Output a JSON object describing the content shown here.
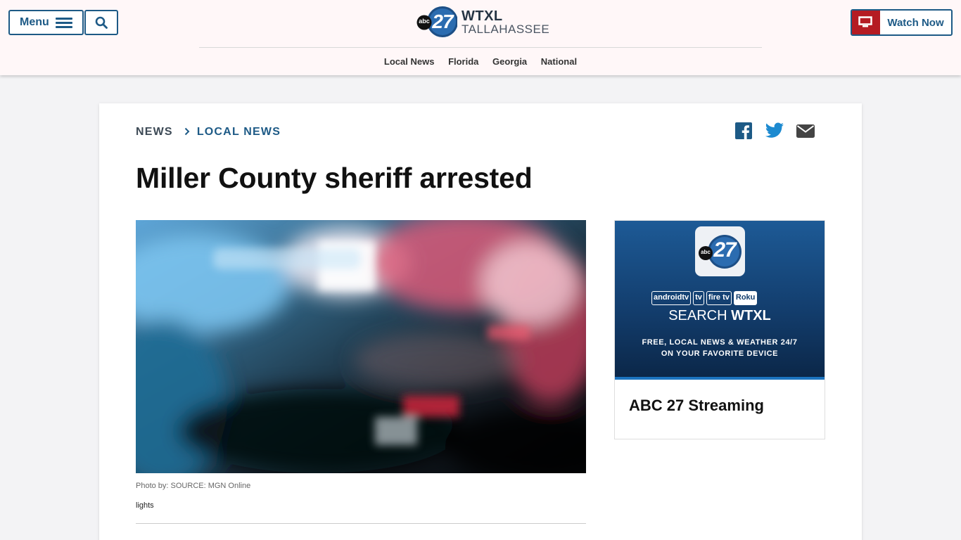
{
  "header": {
    "menu_label": "Menu",
    "logo": {
      "abc": "abc",
      "number": "27",
      "call_sign": "WTXL",
      "city": "TALLAHASSEE"
    },
    "nav": [
      "Local News",
      "Florida",
      "Georgia",
      "National"
    ],
    "watch_label": "Watch Now"
  },
  "breadcrumb": {
    "parent": "NEWS",
    "current": "LOCAL NEWS"
  },
  "share": [
    "facebook-icon",
    "twitter-icon",
    "email-icon"
  ],
  "article": {
    "headline": "Miller County sheriff arrested",
    "photo_credit": "Photo by: SOURCE: MGN Online",
    "caption": "lights"
  },
  "promo": {
    "devices": [
      "androidtv",
      "tv",
      "fire tv",
      "Roku"
    ],
    "search_prefix": "SEARCH ",
    "search_brand": "WTXL",
    "free_line1": "FREE, LOCAL NEWS & WEATHER 24/7",
    "free_line2": "ON YOUR FAVORITE DEVICE",
    "title": "ABC 27 Streaming"
  },
  "colors": {
    "brand_blue": "#1d5a86",
    "accent_red": "#b51b23",
    "promo_blue": "#133e6e"
  }
}
